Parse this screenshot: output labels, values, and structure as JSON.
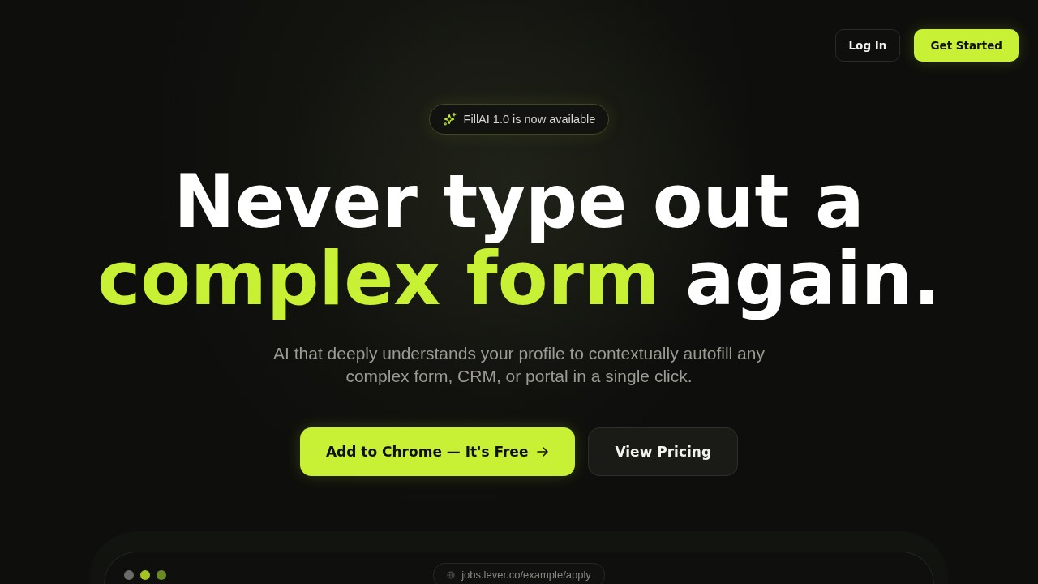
{
  "nav": {
    "buttons": [
      {
        "label": "Log In",
        "kind": "secondary"
      },
      {
        "label": "Get Started",
        "kind": "primary"
      }
    ]
  },
  "announcement": {
    "text": "FillAI 1.0 is now available"
  },
  "hero": {
    "headline": [
      [
        {
          "text": "Never type out a",
          "accent": false
        }
      ],
      [
        {
          "text": "complex form",
          "accent": true
        },
        {
          "text": "again.",
          "accent": false
        }
      ]
    ],
    "subtitle": "AI that deeply understands your profile to contextually autofill any complex form, CRM, or portal in a single click.",
    "buttons": [
      {
        "label": "Add to Chrome — It's Free",
        "kind": "primary",
        "arrow": true
      },
      {
        "label": "View Pricing",
        "kind": "secondary",
        "arrow": false
      }
    ]
  },
  "browser_preview": {
    "dots": [
      {
        "color": "#6b6b68"
      },
      {
        "color": "#a6c41e"
      },
      {
        "color": "#6a8a26"
      }
    ],
    "url": "jobs.lever.co/example/apply"
  }
}
